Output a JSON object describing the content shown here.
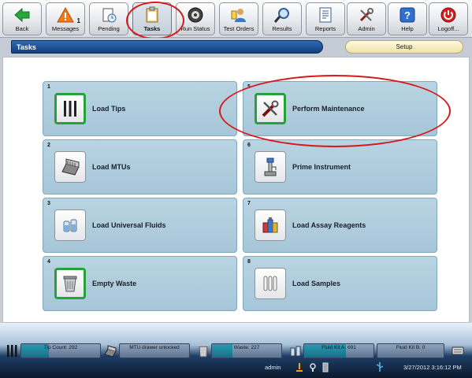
{
  "toolbar": {
    "buttons": [
      {
        "label": "Back",
        "icon": "back-arrow-icon"
      },
      {
        "label": "Messages",
        "icon": "warning-icon",
        "badge": "1"
      },
      {
        "label": "Pending",
        "icon": "pending-icon"
      },
      {
        "label": "Tasks",
        "icon": "clipboard-icon"
      },
      {
        "label": "Run Status",
        "icon": "run-status-icon"
      },
      {
        "label": "Test Orders",
        "icon": "test-orders-icon"
      },
      {
        "label": "Results",
        "icon": "magnifier-icon"
      },
      {
        "label": "Reports",
        "icon": "report-icon"
      },
      {
        "label": "Admin",
        "icon": "tools-icon"
      },
      {
        "label": "Help",
        "icon": "help-icon"
      },
      {
        "label": "Logoff...",
        "icon": "power-icon"
      }
    ]
  },
  "header": {
    "title": "Tasks",
    "setup_label": "Setup"
  },
  "tasks": [
    {
      "num": "1",
      "label": "Load Tips",
      "icon": "tips-icon",
      "done": true
    },
    {
      "num": "5",
      "label": "Perform Maintenance",
      "icon": "maintenance-icon",
      "done": true
    },
    {
      "num": "2",
      "label": "Load MTUs",
      "icon": "mtu-icon",
      "done": false
    },
    {
      "num": "6",
      "label": "Prime Instrument",
      "icon": "prime-icon",
      "done": false
    },
    {
      "num": "3",
      "label": "Load Universal Fluids",
      "icon": "fluids-icon",
      "done": false
    },
    {
      "num": "7",
      "label": "Load Assay Reagents",
      "icon": "reagents-icon",
      "done": false
    },
    {
      "num": "4",
      "label": "Empty Waste",
      "icon": "waste-icon",
      "done": true
    },
    {
      "num": "8",
      "label": "Load Samples",
      "icon": "samples-icon",
      "done": false
    }
  ],
  "status": {
    "tip_count": "Tip Count: 292",
    "mtu_drawer": "MTU drawer unlocked",
    "waste": "Waste: 227",
    "fluid_kit_a": "Fluid Kit A: 691",
    "fluid_kit_b": "Fluid Kit B: 0",
    "user": "admin",
    "datetime": "3/27/2012 3:16:12 PM"
  },
  "colors": {
    "accent_blue": "#1d4f94",
    "task_card": "#b0cde0",
    "done_green": "#27a23a",
    "annotation_red": "#d81818"
  }
}
